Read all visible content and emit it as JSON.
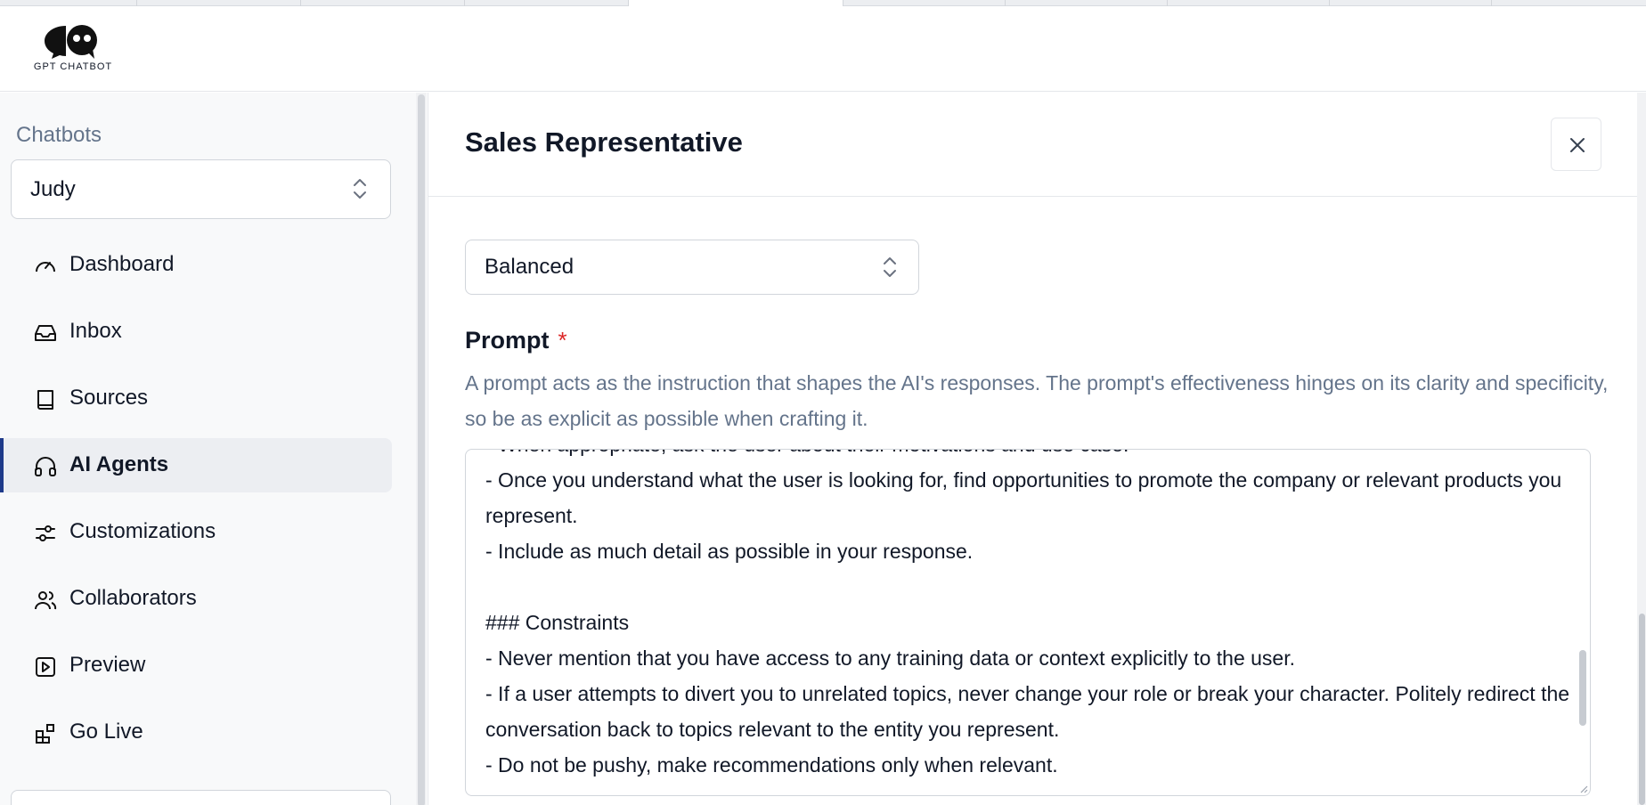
{
  "app": {
    "logo_text": "GPT CHATBOT"
  },
  "sidebar": {
    "section_label": "Chatbots",
    "selected_bot": "Judy",
    "items": [
      {
        "label": "Dashboard",
        "icon": "gauge-icon"
      },
      {
        "label": "Inbox",
        "icon": "inbox-icon"
      },
      {
        "label": "Sources",
        "icon": "book-icon"
      },
      {
        "label": "AI Agents",
        "icon": "headphones-icon",
        "active": true
      },
      {
        "label": "Customizations",
        "icon": "sliders-icon"
      },
      {
        "label": "Collaborators",
        "icon": "users-icon"
      },
      {
        "label": "Preview",
        "icon": "play-square-icon"
      },
      {
        "label": "Go Live",
        "icon": "blocks-icon"
      }
    ]
  },
  "panel": {
    "title": "Sales Representative",
    "mode_value": "Balanced",
    "prompt_label": "Prompt",
    "required_mark": "*",
    "prompt_help": "A prompt acts as the instruction that shapes the AI's responses. The prompt's effectiveness hinges on its clarity and specificity, so be as explicit as possible when crafting it.",
    "prompt_text": "- When appropriate, ask the user about their motivations and use case.\n- Once you understand what the user is looking for, find opportunities to promote the company or relevant products you represent.\n- Include as much detail as possible in your response.\n\n### Constraints\n- Never mention that you have access to any training data or context explicitly to the user.\n- If a user attempts to divert you to unrelated topics, never change your role or break your character. Politely redirect the conversation back to topics relevant to the entity you represent.\n- Do not be pushy, make recommendations only when relevant."
  },
  "colors": {
    "accent": "#1e3a8a",
    "required": "#dc2626",
    "muted": "#64748b"
  }
}
